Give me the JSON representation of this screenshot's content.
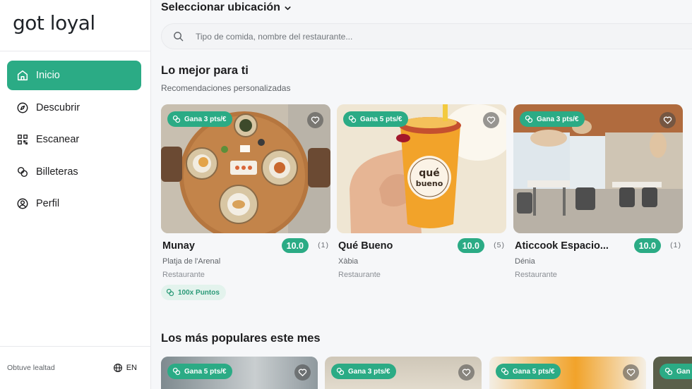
{
  "app": {
    "logo": "got loyal"
  },
  "sidebar": {
    "items": [
      {
        "label": "Inicio",
        "icon": "home-icon",
        "active": true
      },
      {
        "label": "Descubrir",
        "icon": "compass-icon",
        "active": false
      },
      {
        "label": "Escanear",
        "icon": "qr-code-icon",
        "active": false
      },
      {
        "label": "Billeteras",
        "icon": "coins-icon",
        "active": false
      },
      {
        "label": "Perfil",
        "icon": "user-icon",
        "active": false
      }
    ],
    "footer_text": "Obtuve lealtad",
    "language": "EN"
  },
  "header": {
    "location_label": "Seleccionar ubicación",
    "search_placeholder": "Tipo de comida, nombre del restaurante..."
  },
  "recommended": {
    "title": "Lo mejor para ti",
    "subtitle": "Recomendaciones personalizadas",
    "cards": [
      {
        "badge": "Gana 3 pts/€",
        "name": "Munay",
        "rating": "10.0",
        "reviews": "(1)",
        "city": "Platja de l'Arenal",
        "type": "Restaurante",
        "points": "100x Puntos"
      },
      {
        "badge": "Gana 5 pts/€",
        "name": "Qué Bueno",
        "rating": "10.0",
        "reviews": "(5)",
        "city": "Xàbia",
        "type": "Restaurante"
      },
      {
        "badge": "Gana 3 pts/€",
        "name": "Aticcook Espacio...",
        "rating": "10.0",
        "reviews": "(1)",
        "city": "Dénia",
        "type": "Restaurante"
      }
    ]
  },
  "popular": {
    "title": "Los más populares este mes",
    "cards": [
      {
        "badge": "Gana 5 pts/€"
      },
      {
        "badge": "Gana 3 pts/€"
      },
      {
        "badge": "Gana 5 pts/€"
      },
      {
        "badge": "Gan"
      }
    ]
  },
  "colors": {
    "accent": "#2bab85",
    "accent_light": "#e3f3ed",
    "background": "#f6f7f9"
  }
}
